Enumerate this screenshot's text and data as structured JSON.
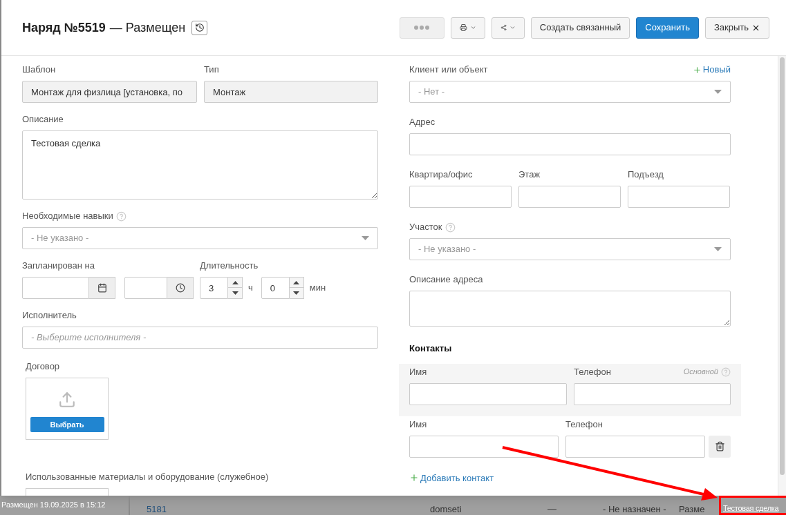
{
  "window": {
    "title": "Наряд №5519",
    "status": "— Размещен"
  },
  "toolbar": [
    {
      "kind": "more"
    },
    {
      "kind": "print"
    },
    {
      "kind": "share"
    },
    {
      "kind": "default",
      "label": "Создать связанный"
    },
    {
      "kind": "primary",
      "label": "Сохранить"
    },
    {
      "kind": "close",
      "label": "Закрыть"
    }
  ],
  "template": {
    "label": "Шаблон",
    "value": "Монтаж для физлица [установка, по"
  },
  "type": {
    "label": "Тип",
    "value": "Монтаж"
  },
  "description": {
    "label": "Описание",
    "value": "Тестовая сделка"
  },
  "skills": {
    "label": "Необходимые навыки",
    "placeholder": "- Не указано -"
  },
  "scheduled": {
    "label": "Запланирован на"
  },
  "duration": {
    "label": "Длительность",
    "hours": "3",
    "hours_unit": "ч",
    "minutes": "0",
    "minutes_unit": "мин"
  },
  "performer": {
    "label": "Исполнитель",
    "placeholder": "- Выберите исполнителя -"
  },
  "contract": {
    "label": "Договор",
    "button": "Выбрать"
  },
  "materials": {
    "label": "Использованные материалы и оборудование (служебное)"
  },
  "client": {
    "label": "Клиент или объект",
    "new_link": "Новый",
    "placeholder": "- Нет -"
  },
  "address": {
    "label": "Адрес"
  },
  "address_parts": [
    {
      "label": "Квартира/офис"
    },
    {
      "label": "Этаж"
    },
    {
      "label": "Подъезд"
    }
  ],
  "district": {
    "label": "Участок",
    "placeholder": "- Не указано -"
  },
  "address_description": {
    "label": "Описание адреса"
  },
  "contacts": {
    "title": "Контакты",
    "primary_hint": "Основной",
    "add_link": "Добавить контакт",
    "items": [
      {
        "name_label": "Имя",
        "phone_label": "Телефон",
        "primary": true
      },
      {
        "name_label": "Имя",
        "phone_label": "Телефон",
        "primary": false
      }
    ]
  },
  "background": {
    "status_note": "Размещен 19.09.2025 в 15:12",
    "cells": [
      "5181",
      "domseti",
      "—",
      "- Не назначен -",
      "Разме"
    ],
    "highlighted_link": "Тестовая сделка"
  }
}
